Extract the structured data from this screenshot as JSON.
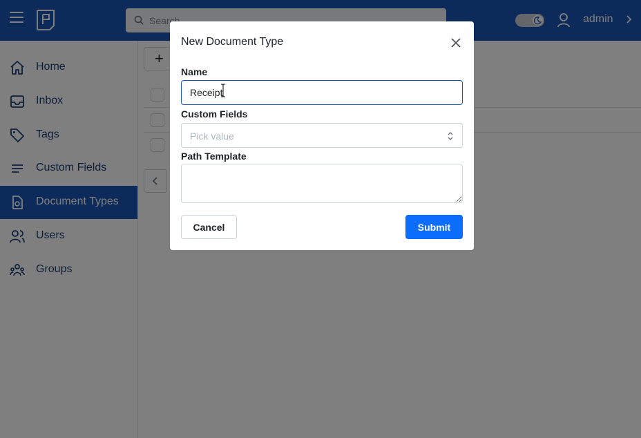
{
  "header": {
    "search_placeholder": "Search",
    "username": "admin"
  },
  "sidebar": {
    "items": [
      {
        "label": "Home",
        "icon": "home-icon"
      },
      {
        "label": "Inbox",
        "icon": "inbox-icon"
      },
      {
        "label": "Tags",
        "icon": "tag-icon"
      },
      {
        "label": "Custom Fields",
        "icon": "list-icon"
      },
      {
        "label": "Document Types",
        "icon": "document-type-icon",
        "active": true
      },
      {
        "label": "Users",
        "icon": "users-icon"
      },
      {
        "label": "Groups",
        "icon": "groups-icon"
      }
    ]
  },
  "modal": {
    "title": "New Document Type",
    "name_label": "Name",
    "name_value": "Receipt",
    "custom_fields_label": "Custom Fields",
    "custom_fields_placeholder": "Pick value",
    "path_template_label": "Path Template",
    "path_template_value": "",
    "cancel_label": "Cancel",
    "submit_label": "Submit"
  },
  "colors": {
    "brand": "#1a56b4",
    "submit": "#0d6efd"
  }
}
